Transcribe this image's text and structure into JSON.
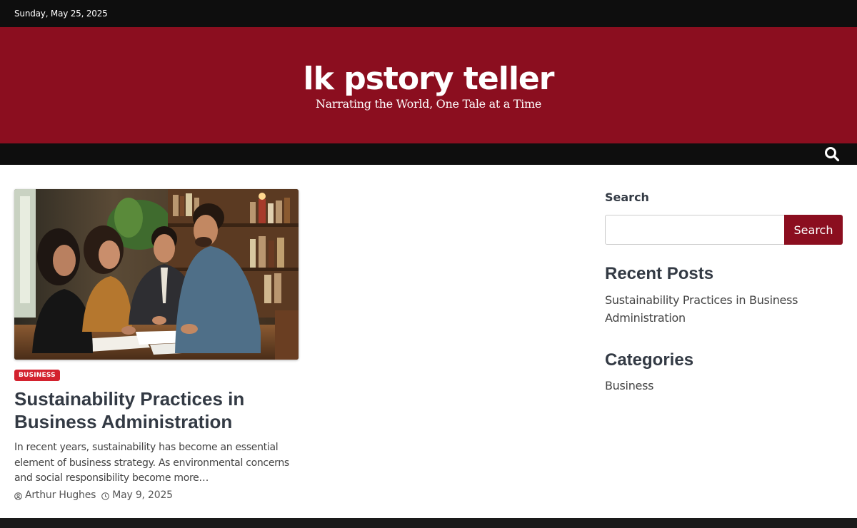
{
  "topbar": {
    "date": "Sunday, May 25, 2025"
  },
  "header": {
    "site_title": "lk pstory teller",
    "tagline": "Narrating the World, One Tale at a Time",
    "brand_color": "#8b0e1f"
  },
  "navbar": {
    "search_icon": "search-icon"
  },
  "post": {
    "category": "BUSINESS",
    "title": "Sustainability Practices in Business Administration",
    "excerpt": "In recent years, sustainability has become an essential element of business strategy. As environmental concerns and social responsibility become more…",
    "author": "Arthur Hughes",
    "date": "May 9, 2025",
    "author_icon": "user-icon",
    "date_icon": "clock-icon"
  },
  "sidebar": {
    "search_label": "Search",
    "search_value": "",
    "search_button": "Search",
    "recent_posts_title": "Recent Posts",
    "recent_posts": [
      "Sustainability Practices in Business Administration"
    ],
    "categories_title": "Categories",
    "categories": [
      "Business"
    ]
  }
}
